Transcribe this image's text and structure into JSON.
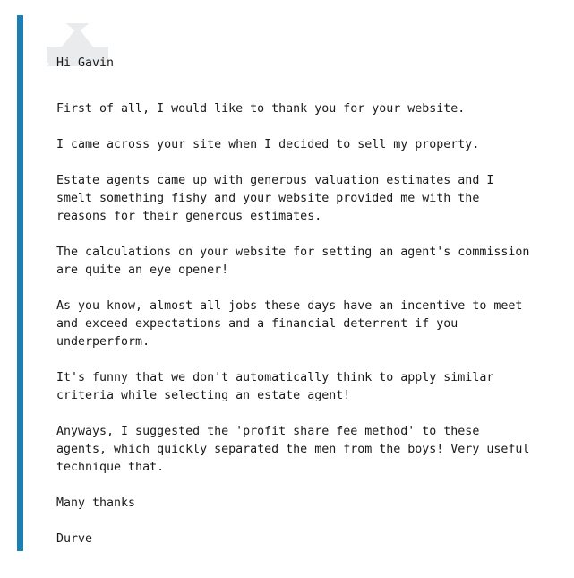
{
  "theme": {
    "accent_color": "#1b7fb4",
    "text_color": "#1a1a1a",
    "watermark_color": "#e9ebed",
    "background_color": "#ffffff"
  },
  "icons": {
    "envelope": "envelope-icon"
  },
  "testimonial": {
    "greeting": "Hi Gavin",
    "paragraphs": [
      "First of all, I would like to thank you for your website.",
      "I came across your site when I decided to sell my property.",
      "Estate agents came up with generous valuation estimates and I\nsmelt something fishy and your website provided me with the\nreasons for their generous estimates.",
      "The calculations on your website for setting an agent's commission\nare quite an eye opener!",
      "As you know, almost all jobs these days have an incentive to meet\nand exceed expectations and a financial deterrent if you\nunderperform.",
      "It's funny that we don't automatically think to apply similar\ncriteria while selecting an estate agent!",
      "Anyways, I suggested the 'profit share fee method' to these\nagents, which quickly separated the men from the boys! Very useful\ntechnique that."
    ],
    "signoff": "Many thanks",
    "signature": "Durve"
  }
}
